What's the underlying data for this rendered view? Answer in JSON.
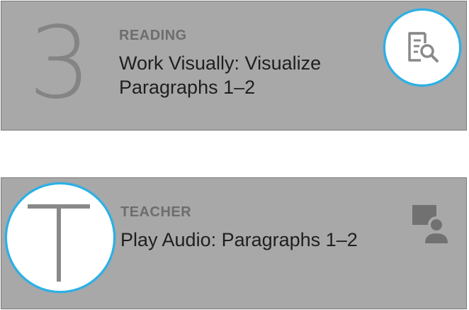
{
  "cards": [
    {
      "number": "3",
      "category": "READING",
      "title_line1": "Work Visually: Visualize",
      "title_line2": "Paragraphs 1–2",
      "icon": "document-search-icon"
    },
    {
      "number": "T",
      "category": "TEACHER",
      "title_line1": "Play Audio: Paragraphs 1–2",
      "icon": "teacher-presentation-icon"
    }
  ],
  "colors": {
    "card_background": "#a9a8a9",
    "highlight_ring": "#2ab0e6",
    "glyph": "#858485",
    "category_text": "#6e6d6e",
    "title_text": "#1f1f1f"
  }
}
